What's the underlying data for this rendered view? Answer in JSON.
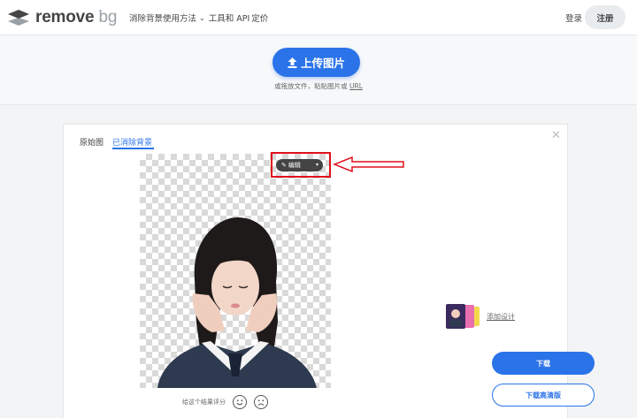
{
  "header": {
    "logo_text_main": "remove",
    "logo_text_bg": "bg",
    "nav_how": "消除背景使用方法",
    "nav_tools": "工具和 API",
    "nav_pricing": "定价",
    "login": "登录",
    "signup": "注册"
  },
  "upload": {
    "button_label": "上传图片",
    "hint_prefix": "或拖放文件，粘贴图片或",
    "hint_url": "URL"
  },
  "card": {
    "tabs": [
      {
        "label": "原始图",
        "active": false
      },
      {
        "label": "已消除背景",
        "active": true
      }
    ],
    "edit_label": "编辑",
    "download_label": "下载",
    "download_hd_label": "下载高清版",
    "add_design_label": "添加设计",
    "rating_label": "给这个结果评分"
  },
  "colors": {
    "accent": "#2b73e8",
    "highlight": "#e0101a"
  },
  "icons": [
    "upload-icon",
    "pencil-icon",
    "caret-down-icon",
    "close-icon",
    "smile-icon",
    "frown-icon",
    "chevron-down-icon"
  ]
}
